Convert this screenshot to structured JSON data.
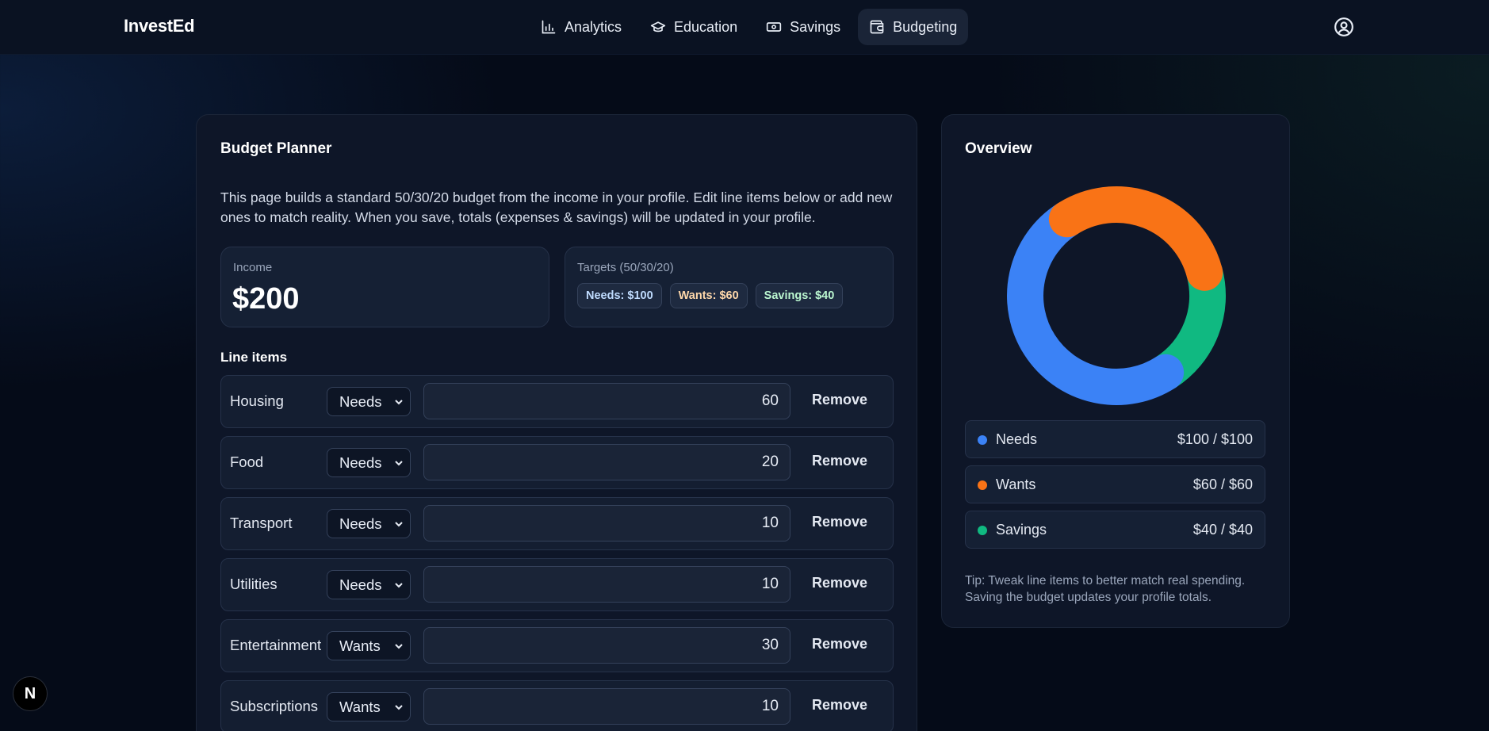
{
  "app": {
    "brand": "InvestEd"
  },
  "nav": {
    "items": [
      {
        "label": "Analytics",
        "icon": "bar-chart-icon"
      },
      {
        "label": "Education",
        "icon": "graduation-cap-icon"
      },
      {
        "label": "Savings",
        "icon": "banknote-icon"
      },
      {
        "label": "Budgeting",
        "icon": "wallet-icon",
        "active": true
      }
    ]
  },
  "planner": {
    "title": "Budget Planner",
    "description": "This page builds a standard 50/30/20 budget from the income in your profile. Edit line items below or add new ones to match reality. When you save, totals (expenses & savings) will be updated in your profile.",
    "income_label": "Income",
    "income_value": "$200",
    "targets_label": "Targets (50/30/20)",
    "targets": {
      "needs": "Needs: $100",
      "wants": "Wants: $60",
      "savings": "Savings: $40"
    },
    "line_items_label": "Line items",
    "remove_label": "Remove",
    "rows": [
      {
        "name": "Housing",
        "category": "Needs",
        "amount": "60"
      },
      {
        "name": "Food",
        "category": "Needs",
        "amount": "20"
      },
      {
        "name": "Transport",
        "category": "Needs",
        "amount": "10"
      },
      {
        "name": "Utilities",
        "category": "Needs",
        "amount": "10"
      },
      {
        "name": "Entertainment",
        "category": "Wants",
        "amount": "30"
      },
      {
        "name": "Subscriptions",
        "category": "Wants",
        "amount": "10"
      }
    ]
  },
  "overview": {
    "title": "Overview",
    "legend": [
      {
        "name": "Needs",
        "value": "$100 / $100",
        "color": "#3b82f6"
      },
      {
        "name": "Wants",
        "value": "$60 / $60",
        "color": "#f97316"
      },
      {
        "name": "Savings",
        "value": "$40 / $40",
        "color": "#10b981"
      }
    ],
    "tip": "Tip: Tweak line items to better match real spending. Saving the budget updates your profile totals."
  },
  "chart_data": {
    "type": "pie",
    "categories": [
      "Needs",
      "Wants",
      "Savings"
    ],
    "values": [
      100,
      60,
      40
    ],
    "colors": [
      "#3b82f6",
      "#f97316",
      "#10b981"
    ],
    "title": ""
  },
  "badge": {
    "label": "N"
  }
}
